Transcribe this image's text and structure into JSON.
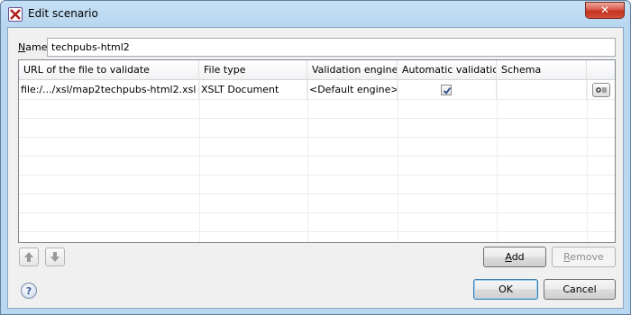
{
  "window": {
    "title": "Edit scenario",
    "close_label": "✕"
  },
  "name_field": {
    "label_mnemonic": "N",
    "label_rest": "ame",
    "value": "techpubs-html2"
  },
  "table": {
    "columns": [
      "URL of the file to validate",
      "File type",
      "Validation engine",
      "Automatic validation",
      "Schema"
    ],
    "rows": [
      {
        "url": "file:/.../xsl/map2techpubs-html2.xsl",
        "file_type": "XSLT Document",
        "engine": "<Default engine>",
        "automatic_validation": true,
        "schema": ""
      }
    ]
  },
  "buttons": {
    "add_mnemonic": "A",
    "add_rest": "dd",
    "remove_mnemonic": "R",
    "remove_rest": "emove",
    "ok": "OK",
    "cancel": "Cancel",
    "help": "?"
  }
}
